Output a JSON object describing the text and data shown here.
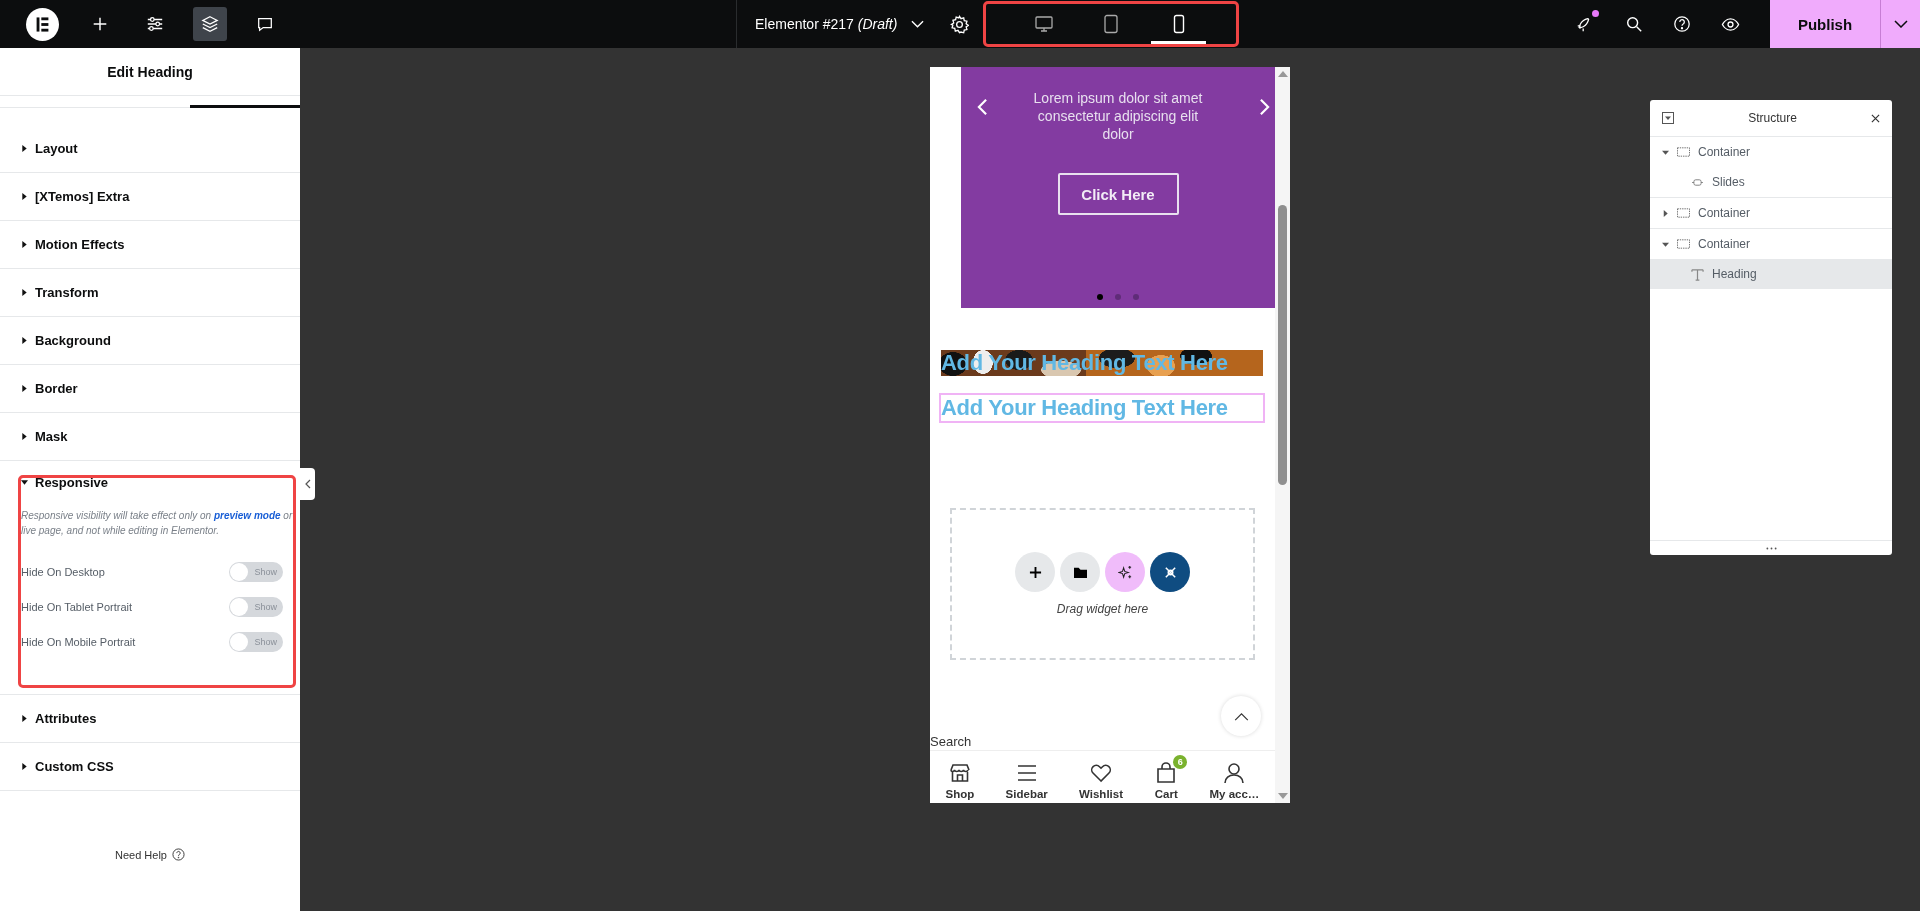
{
  "topbar": {
    "document_title": "Elementor #217",
    "document_status": "(Draft)",
    "tools": [
      {
        "kind": "add",
        "selected": false
      },
      {
        "kind": "settings",
        "selected": false
      },
      {
        "kind": "layers",
        "selected": true
      },
      {
        "kind": "comments",
        "selected": false
      }
    ],
    "devices": [
      {
        "kind": "desktop",
        "selected": false
      },
      {
        "kind": "tablet",
        "selected": false
      },
      {
        "kind": "mobile",
        "selected": true
      }
    ],
    "notification": true,
    "publish": "Publish"
  },
  "panel": {
    "title": "Edit Heading",
    "sections": [
      {
        "label": "Layout",
        "expanded": false
      },
      {
        "label": "[XTemos] Extra",
        "expanded": false
      },
      {
        "label": "Motion Effects",
        "expanded": false
      },
      {
        "label": "Transform",
        "expanded": false
      },
      {
        "label": "Background",
        "expanded": false
      },
      {
        "label": "Border",
        "expanded": false
      },
      {
        "label": "Mask",
        "expanded": false
      },
      {
        "label": "Responsive",
        "expanded": true,
        "note_before": "Responsive visibility will take effect only on",
        "note_link": "preview mode",
        "note_after": "or live page, and not while editing in Elementor.",
        "toggles": [
          {
            "label": "Hide On Desktop",
            "on": false,
            "state_text": "Show"
          },
          {
            "label": "Hide On Tablet Portrait",
            "on": false,
            "state_text": "Show"
          },
          {
            "label": "Hide On Mobile Portrait",
            "on": false,
            "state_text": "Show"
          }
        ]
      },
      {
        "label": "Attributes",
        "expanded": false
      },
      {
        "label": "Custom CSS",
        "expanded": false
      }
    ],
    "help": "Need Help"
  },
  "preview": {
    "slide": {
      "text": "Lorem ipsum dolor sit amet consectetur adipiscing elit dolor",
      "button": "Click Here",
      "dots": [
        {
          "selected": true
        },
        {
          "selected": false
        },
        {
          "selected": false
        }
      ]
    },
    "headings": [
      {
        "text": "Add Your Heading Text Here",
        "kind": "picture",
        "selected": false
      },
      {
        "text": "Add Your Heading Text Here",
        "kind": "plain",
        "selected": true
      }
    ],
    "drop_zone": {
      "hint": "Drag widget here",
      "buttons": [
        {
          "kind": "add"
        },
        {
          "kind": "template"
        },
        {
          "kind": "ai"
        },
        {
          "kind": "kit"
        }
      ]
    },
    "search_text": "Search",
    "bottom_nav": [
      {
        "label": "Shop",
        "kind": "shop"
      },
      {
        "label": "Sidebar",
        "kind": "sidebar"
      },
      {
        "label": "Wishlist",
        "kind": "wishlist"
      },
      {
        "label": "Cart",
        "kind": "cart",
        "badge": "6"
      },
      {
        "label": "My acc…",
        "kind": "account"
      }
    ]
  },
  "structure": {
    "title": "Structure",
    "items": [
      {
        "label": "Container",
        "kind": "container",
        "expanded": true,
        "selected": false,
        "children": [
          {
            "label": "Slides",
            "kind": "slides",
            "selected": false
          }
        ]
      },
      {
        "label": "Container",
        "kind": "container",
        "expanded": false,
        "selected": false
      },
      {
        "label": "Container",
        "kind": "container",
        "expanded": true,
        "selected": false,
        "children": [
          {
            "label": "Heading",
            "kind": "heading",
            "selected": true
          }
        ]
      }
    ]
  }
}
